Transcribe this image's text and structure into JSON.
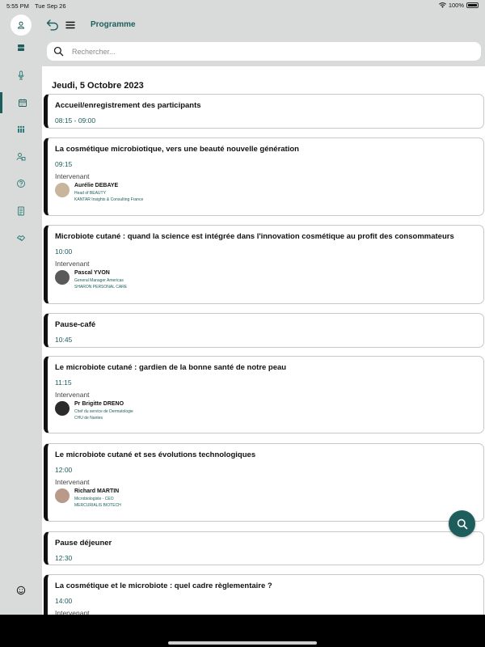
{
  "status_bar": {
    "time": "5:55 PM",
    "date": "Tue Sep 26",
    "battery": "100%"
  },
  "header": {
    "title": "Programme"
  },
  "search": {
    "placeholder": "Rechercher..."
  },
  "day": {
    "title": "Jeudi, 5 Octobre 2023"
  },
  "speaker_label": "Intervenant",
  "sessions": [
    {
      "title": "Accueil/enregistrement des participants",
      "time": "08:15 - 09:00"
    },
    {
      "title": "La cosmétique microbiotique, vers une beauté nouvelle génération",
      "time": "09:15",
      "speaker": {
        "name": "Aurélie DEBAYE",
        "role": "Head of BEAUTY",
        "company": "KANTAR Insights & Consulting France"
      }
    },
    {
      "title": "Microbiote cutané : quand la science est intégrée dans l'innovation cosmétique au profit des consommateurs",
      "time": "10:00",
      "speaker": {
        "name": "Pascal YVON",
        "role": "General Manager Americas",
        "company": "SHARON PERSONAL CARE"
      }
    },
    {
      "title": "Pause-café",
      "time": "10:45"
    },
    {
      "title": "Le microbiote cutané : gardien de la bonne santé de notre peau",
      "time": "11:15",
      "speaker": {
        "name": "Pr Brigitte DRENO",
        "role": "Chef du service de Dermatologie",
        "company": "CHU de Nantes"
      }
    },
    {
      "title": "Le microbiote cutané et ses évolutions technologiques",
      "time": "12:00",
      "speaker": {
        "name": "Richard MARTIN",
        "role": "Microbiologiste - CEO",
        "company": "MERCURIALIS BIOTECH"
      }
    },
    {
      "title": "Pause déjeuner",
      "time": "12:30"
    },
    {
      "title": "La cosmétique et le microbiote : quel cadre règlementaire ?",
      "time": "14:00"
    }
  ],
  "colors": {
    "accent": "#1d5e5c",
    "sidebar_bg": "#d9dbdb",
    "card_bar": "#111111"
  }
}
